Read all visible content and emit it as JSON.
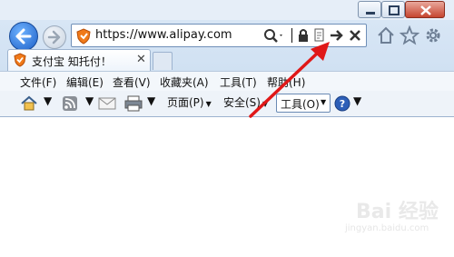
{
  "address_bar": {
    "url": "https://www.alipay.com"
  },
  "tab": {
    "title": "支付宝 知托付！",
    "close": "✕"
  },
  "menu": {
    "items": [
      "文件(F)",
      "编辑(E)",
      "查看(V)",
      "收藏夹(A)",
      "工具(T)",
      "帮助(H)"
    ]
  },
  "command_bar": {
    "page": "页面(P)",
    "safety": "安全(S)",
    "tools": "工具(O)"
  },
  "watermark": {
    "logo": "Bai 经验",
    "url": "jingyan.baidu.com"
  },
  "icons": {
    "back": "back-arrow-icon",
    "forward": "forward-arrow-icon",
    "favicon": "alipay-shield-icon",
    "search": "search-icon",
    "lock": "lock-icon",
    "compat": "compatibility-icon",
    "go": "go-arrow-icon",
    "stop": "stop-icon",
    "home": "home-icon",
    "favorites": "favorites-star-icon",
    "settings": "gear-icon",
    "rss": "rss-icon",
    "mail": "mail-icon",
    "print": "print-icon",
    "help": "help-icon"
  },
  "colors": {
    "accent": "#1c5fc7",
    "annotation_arrow": "#e01818"
  }
}
